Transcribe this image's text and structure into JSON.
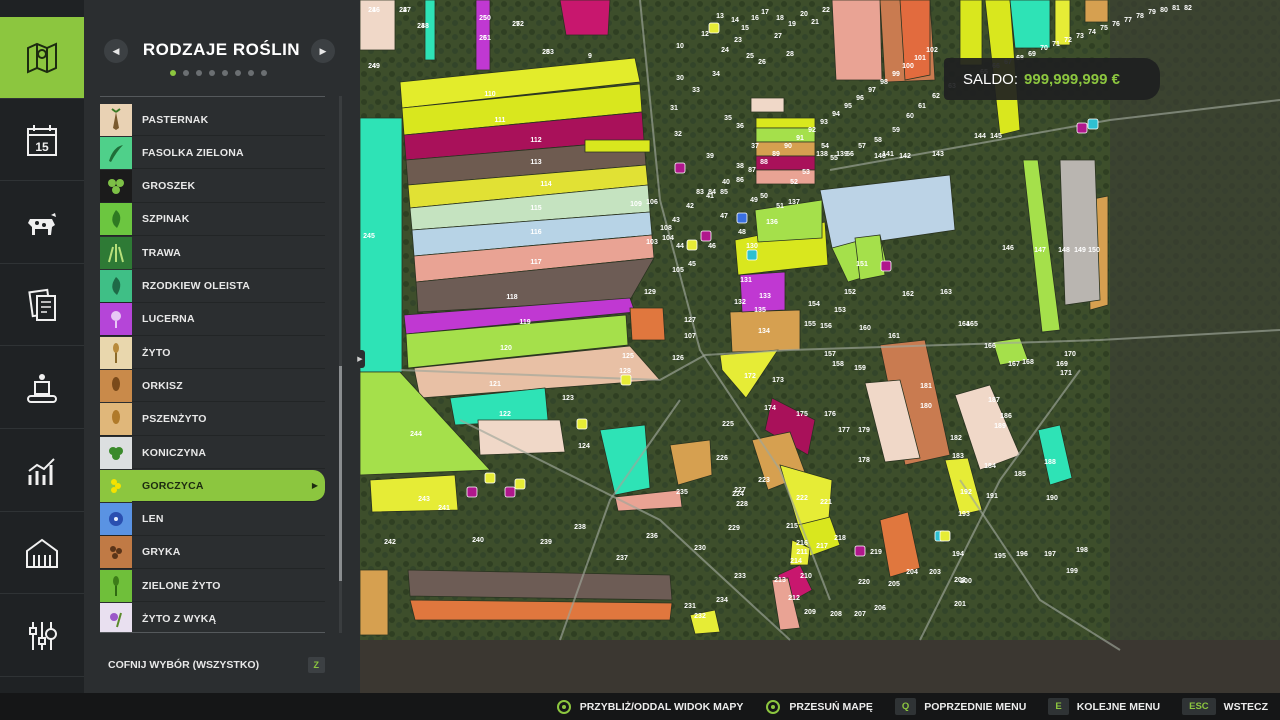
{
  "panel": {
    "title": "RODZAJE ROŚLIN",
    "prev_icon": "chevron-left-icon",
    "next_icon": "chevron-right-icon",
    "pages_total": 8,
    "page_current": 1,
    "items": [
      {
        "label": "PASTERNAK",
        "icon": "parsnip-icon",
        "color": "#e9d2b4"
      },
      {
        "label": "FASOLKA ZIELONA",
        "icon": "green-bean-icon",
        "color": "#4fd08a"
      },
      {
        "label": "GROSZEK",
        "icon": "pea-icon",
        "color": "#1b1b1b"
      },
      {
        "label": "SZPINAK",
        "icon": "spinach-icon",
        "color": "#6cc640"
      },
      {
        "label": "TRAWA",
        "icon": "grass-icon",
        "color": "#2e7a35"
      },
      {
        "label": "RZODKIEW OLEISTA",
        "icon": "oilseed-radish-icon",
        "color": "#3fbf86"
      },
      {
        "label": "LUCERNA",
        "icon": "alfalfa-icon",
        "color": "#b545d8"
      },
      {
        "label": "ŻYTO",
        "icon": "rye-icon",
        "color": "#e9d7ad"
      },
      {
        "label": "ORKISZ",
        "icon": "spelt-icon",
        "color": "#c98a4a"
      },
      {
        "label": "PSZENŻYTO",
        "icon": "triticale-icon",
        "color": "#e0b77a"
      },
      {
        "label": "KONICZYNA",
        "icon": "clover-icon",
        "color": "#dcdfe0"
      },
      {
        "label": "GORCZYCA",
        "icon": "mustard-icon",
        "color": "#8cc63f",
        "selected": true
      },
      {
        "label": "LEN",
        "icon": "flax-icon",
        "color": "#5a93e3"
      },
      {
        "label": "GRYKA",
        "icon": "buckwheat-icon",
        "color": "#c07a45"
      },
      {
        "label": "ZIELONE ŻYTO",
        "icon": "green-rye-icon",
        "color": "#6fbf3a"
      },
      {
        "label": "ŻYTO Z WYKĄ",
        "icon": "rye-vetch-icon",
        "color": "#e9e0f0"
      }
    ],
    "reset_label": "COFNIJ WYBÓR (WSZYSTKO)",
    "reset_key": "Z"
  },
  "rail": [
    {
      "icon": "map-icon",
      "active": true
    },
    {
      "icon": "calendar-icon",
      "day": "15"
    },
    {
      "icon": "cow-icon"
    },
    {
      "icon": "contracts-icon"
    },
    {
      "icon": "production-icon"
    },
    {
      "icon": "statistics-icon"
    },
    {
      "icon": "farm-building-icon"
    },
    {
      "icon": "settings-sliders-icon"
    }
  ],
  "saldo": {
    "label": "SALDO:",
    "value": "999,999,999 €"
  },
  "bottom_bar": [
    {
      "key_icon": "right-stick-icon",
      "label": "PRZYBLIŻ/ODDAL WIDOK MAPY"
    },
    {
      "key_icon": "left-stick-icon",
      "label": "PRZESUŃ MAPĘ"
    },
    {
      "key": "Q",
      "label": "POPRZEDNIE MENU"
    },
    {
      "key": "E",
      "label": "KOLEJNE MENU"
    },
    {
      "key": "ESC",
      "label": "WSTECZ"
    }
  ],
  "map": {
    "field_numbers": [
      "1",
      "2",
      "3",
      "4",
      "5",
      "6",
      "7",
      "8",
      "9",
      "10",
      "12",
      "13",
      "14",
      "15",
      "16",
      "17",
      "18",
      "19",
      "20",
      "21",
      "22",
      "23",
      "24",
      "25",
      "26",
      "27",
      "28",
      "30",
      "31",
      "32",
      "33",
      "34",
      "35",
      "36",
      "37",
      "38",
      "39",
      "40",
      "41",
      "42",
      "43",
      "44",
      "45",
      "46",
      "47",
      "48",
      "49",
      "50",
      "51",
      "52",
      "53",
      "54",
      "55",
      "56",
      "57",
      "58",
      "59",
      "60",
      "61",
      "62",
      "63",
      "64",
      "65",
      "66",
      "67",
      "68",
      "69",
      "70",
      "71",
      "72",
      "73",
      "74",
      "75",
      "76",
      "77",
      "78",
      "79",
      "80",
      "81",
      "82",
      "83",
      "84",
      "85",
      "86",
      "87",
      "88",
      "89",
      "90",
      "91",
      "92",
      "93",
      "94",
      "95",
      "96",
      "97",
      "98",
      "99",
      "100",
      "101",
      "102",
      "103",
      "104",
      "105",
      "106",
      "107",
      "108",
      "109",
      "110",
      "111",
      "112",
      "113",
      "114",
      "115",
      "116",
      "117",
      "118",
      "119",
      "120",
      "121",
      "122",
      "123",
      "124",
      "125",
      "126",
      "127",
      "128",
      "129",
      "130",
      "131",
      "132",
      "133",
      "134",
      "135",
      "136",
      "137",
      "138",
      "139",
      "140",
      "141",
      "142",
      "143",
      "144",
      "145",
      "146",
      "147",
      "148",
      "149",
      "150",
      "151",
      "152",
      "153",
      "154",
      "155",
      "156",
      "157",
      "158",
      "159",
      "160",
      "161",
      "162",
      "163",
      "164",
      "165",
      "166",
      "167",
      "168",
      "169",
      "170",
      "171",
      "172",
      "173",
      "174",
      "175",
      "176",
      "177",
      "178",
      "179",
      "180",
      "181",
      "182",
      "183",
      "184",
      "185",
      "186",
      "187",
      "188",
      "189",
      "190",
      "191",
      "192",
      "193",
      "194",
      "195",
      "196",
      "197",
      "198",
      "199",
      "200",
      "201",
      "202",
      "203",
      "204",
      "205",
      "206",
      "207",
      "208",
      "209",
      "210",
      "211",
      "212",
      "213",
      "214",
      "215",
      "216",
      "217",
      "218",
      "219",
      "220",
      "221",
      "222",
      "223",
      "224",
      "225",
      "226",
      "227",
      "228",
      "229",
      "230",
      "231",
      "232",
      "233",
      "234",
      "235",
      "236",
      "237",
      "238",
      "239",
      "240",
      "241",
      "242",
      "243",
      "244",
      "245",
      "246",
      "247",
      "248",
      "249",
      "250",
      "251",
      "252",
      "253"
    ]
  }
}
